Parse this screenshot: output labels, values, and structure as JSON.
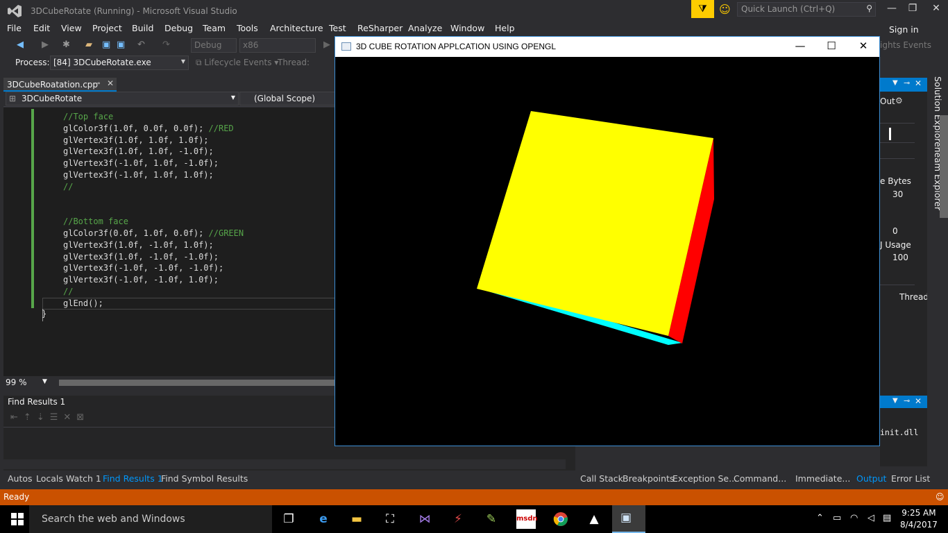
{
  "window": {
    "title": "3DCubeRotate (Running) - Microsoft Visual Studio",
    "quick_launch_placeholder": "Quick Launch (Ctrl+Q)",
    "min": "—",
    "max": "❐",
    "close": "✕"
  },
  "menu": {
    "items": [
      "File",
      "Edit",
      "View",
      "Project",
      "Build",
      "Debug",
      "Team",
      "Tools",
      "Architecture",
      "Test",
      "ReSharper",
      "Analyze",
      "Window",
      "Help"
    ],
    "sign_in": "Sign in"
  },
  "toolbar": {
    "config": "Debug",
    "platform": "x86",
    "insights": "ights Events"
  },
  "process": {
    "label": "Process:",
    "value": "[84] 3DCubeRotate.exe",
    "lifecycle": "Lifecycle Events",
    "thread": "Thread:"
  },
  "doc_tab": {
    "name": "3DCubeRoatation.cpp"
  },
  "nav": {
    "project": "3DCubeRotate",
    "scope": "(Global Scope)"
  },
  "code_lines": [
    {
      "code": "",
      "comment": "//Top face"
    },
    {
      "code": "glColor3f(1.0f, 0.0f, 0.0f); ",
      "comment": "//RED"
    },
    {
      "code": "glVertex3f(1.0f, 1.0f, 1.0f);",
      "comment": ""
    },
    {
      "code": "glVertex3f(1.0f, 1.0f, -1.0f);",
      "comment": ""
    },
    {
      "code": "glVertex3f(-1.0f, 1.0f, -1.0f);",
      "comment": ""
    },
    {
      "code": "glVertex3f(-1.0f, 1.0f, 1.0f);",
      "comment": ""
    },
    {
      "code": "",
      "comment": "//"
    },
    {
      "code": "",
      "comment": ""
    },
    {
      "code": "",
      "comment": ""
    },
    {
      "code": "",
      "comment": "//Bottom face"
    },
    {
      "code": "glColor3f(0.0f, 1.0f, 0.0f); ",
      "comment": "//GREEN"
    },
    {
      "code": "glVertex3f(1.0f, -1.0f, 1.0f);",
      "comment": ""
    },
    {
      "code": "glVertex3f(1.0f, -1.0f, -1.0f);",
      "comment": ""
    },
    {
      "code": "glVertex3f(-1.0f, -1.0f, -1.0f);",
      "comment": ""
    },
    {
      "code": "glVertex3f(-1.0f, -1.0f, 1.0f);",
      "comment": ""
    },
    {
      "code": "",
      "comment": "//"
    },
    {
      "code": "glEnd();",
      "comment": ""
    }
  ],
  "closing_brace": "}",
  "zoom": "99 %",
  "find_results": {
    "title": "Find Results 1"
  },
  "bottom_tabs_left": [
    {
      "label": "Autos",
      "active": false
    },
    {
      "label": "Locals",
      "active": false
    },
    {
      "label": "Watch 1",
      "active": false
    },
    {
      "label": "Find Results 1",
      "active": true
    },
    {
      "label": "Find Symbol Results",
      "active": false
    }
  ],
  "bottom_tabs_right": [
    {
      "label": "Call Stack",
      "active": false
    },
    {
      "label": "Breakpoints",
      "active": false
    },
    {
      "label": "Exception Se...",
      "active": false
    },
    {
      "label": "Command...",
      "active": false
    },
    {
      "label": "Immediate...",
      "active": false
    },
    {
      "label": "Output",
      "active": true
    },
    {
      "label": "Error List",
      "active": false
    }
  ],
  "right_panel": {
    "out": "Out",
    "bytes": "e Bytes",
    "v30": "30",
    "v0": "0",
    "usage": "J Usage",
    "v100": "100",
    "thread": "Thread",
    "dll": "init.dll"
  },
  "vertical_tabs": [
    "Solution Explorer",
    "Team Explorer"
  ],
  "status": "Ready",
  "taskbar": {
    "search": "Search the web and Windows",
    "time": "9:25 AM",
    "date": "8/4/2017"
  },
  "gl_window": {
    "title": "3D CUBE ROTATION APPLCATION USING OPENGL",
    "min": "—",
    "max": "☐",
    "close": "✕"
  },
  "colors": {
    "accent": "#007acc",
    "status": "#ca5100",
    "cube_front": "#ffff00",
    "cube_right": "#ff0000",
    "cube_bottom": "#00ffff"
  }
}
